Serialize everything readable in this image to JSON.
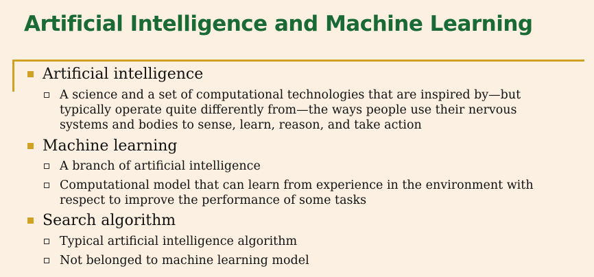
{
  "slide": {
    "title": "Artificial Intelligence and Machine Learning",
    "accent_color": "#d1a124",
    "title_color": "#1a6a35",
    "background_color": "#fbf0e1",
    "sections": [
      {
        "heading": "Artificial intelligence",
        "items": [
          {
            "lines": [
              "A science and a set of computational technologies that are inspired by—but",
              "typically operate quite differently from—the ways people use their nervous",
              "systems and bodies to sense, learn, reason, and take action"
            ]
          }
        ]
      },
      {
        "heading": "Machine learning",
        "items": [
          {
            "lines": [
              "A branch of artificial intelligence"
            ]
          },
          {
            "lines": [
              "Computational model that can learn from experience in the environment with",
              "respect to improve the performance of some tasks"
            ]
          }
        ]
      },
      {
        "heading": "Search algorithm",
        "items": [
          {
            "lines": [
              "Typical artificial intelligence algorithm"
            ]
          },
          {
            "lines": [
              "Not belonged to machine learning model"
            ]
          }
        ]
      }
    ]
  }
}
